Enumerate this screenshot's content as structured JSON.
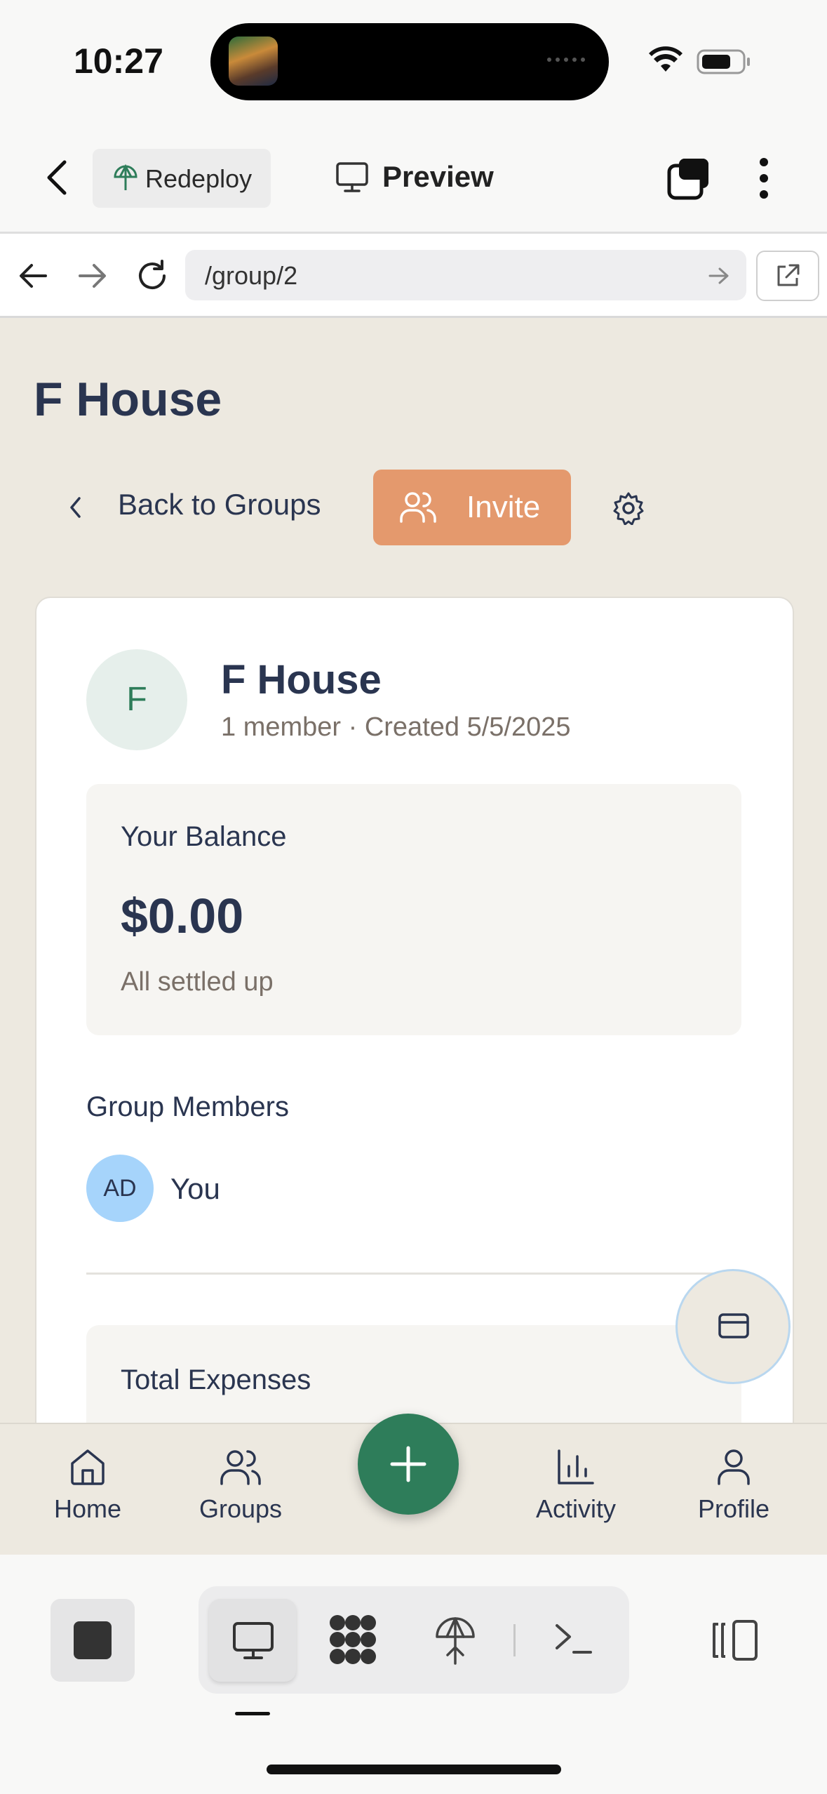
{
  "status_bar": {
    "time": "10:27"
  },
  "topbar": {
    "redeploy_label": "Redeploy",
    "preview_label": "Preview"
  },
  "url_bar": {
    "url": "/group/2"
  },
  "page": {
    "title": "F House",
    "back_label": "Back to Groups",
    "invite_label": "Invite"
  },
  "group": {
    "initial": "F",
    "name": "F House",
    "meta": "1 member · Created 5/5/2025"
  },
  "balance": {
    "label": "Your Balance",
    "amount": "$0.00",
    "status": "All settled up"
  },
  "members": {
    "heading": "Group Members",
    "items": [
      {
        "initials": "AD",
        "name": "You"
      }
    ]
  },
  "expenses": {
    "label": "Total Expenses"
  },
  "bottom_nav": {
    "items": [
      {
        "label": "Home",
        "icon": "home-icon"
      },
      {
        "label": "Groups",
        "icon": "users-icon"
      },
      {
        "label": "Activity",
        "icon": "bar-chart-icon"
      },
      {
        "label": "Profile",
        "icon": "user-icon"
      }
    ]
  },
  "colors": {
    "accent_green": "#2e7d5a",
    "invite_orange": "#e4996d",
    "content_bg": "#ede9e0",
    "text_navy": "#2a3550"
  }
}
